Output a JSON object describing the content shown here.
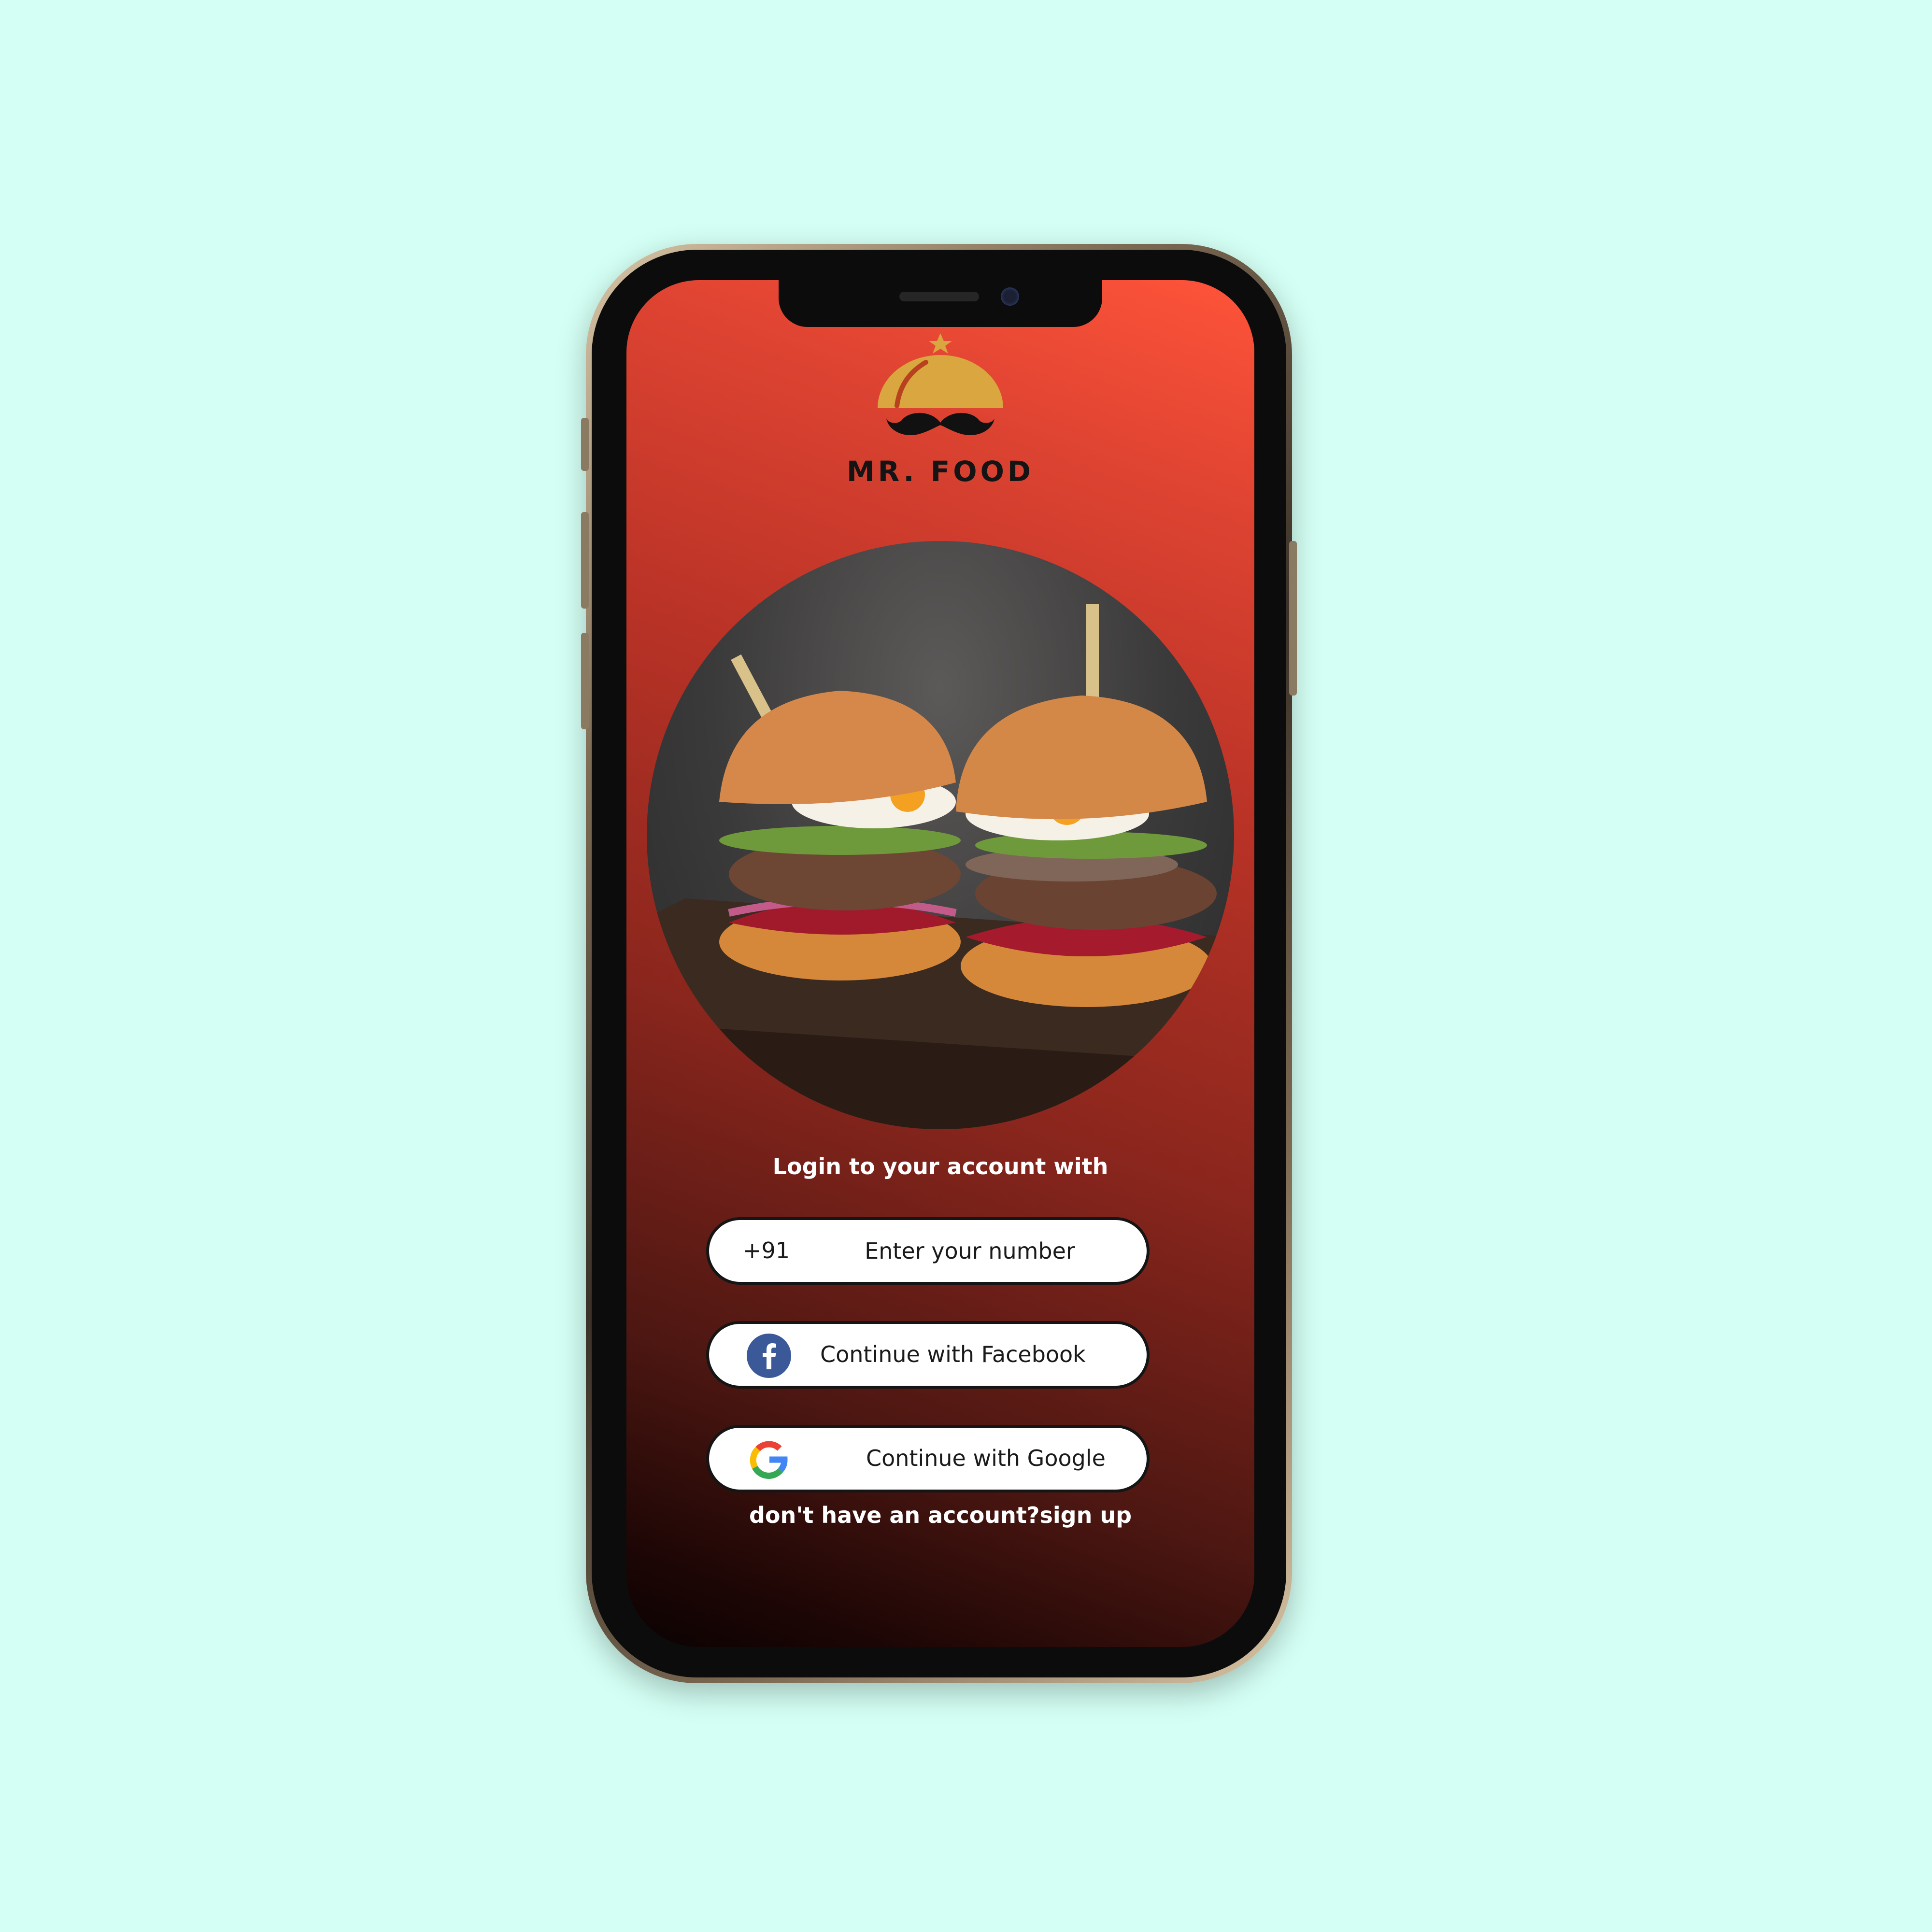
{
  "colors": {
    "page_background": "#d4fff4",
    "screen_gradient_top": "#ff543a",
    "screen_gradient_bottom": "#0b0202",
    "logo_gold": "#d9a63f",
    "facebook_blue": "#3b5998"
  },
  "brand": {
    "name": "MR. FOOD",
    "logo_icon": "cloche-mustache-icon",
    "hero_image": "burgers-photo"
  },
  "login": {
    "heading": "Login  to your account with",
    "phone": {
      "country_code": "+91",
      "placeholder": "Enter your number",
      "value": ""
    },
    "facebook_button": {
      "label": "Continue with Facebook",
      "icon": "facebook-icon"
    },
    "google_button": {
      "label": "Continue with Google",
      "icon": "google-icon"
    },
    "signup_text": "don't have an account?sign up"
  }
}
